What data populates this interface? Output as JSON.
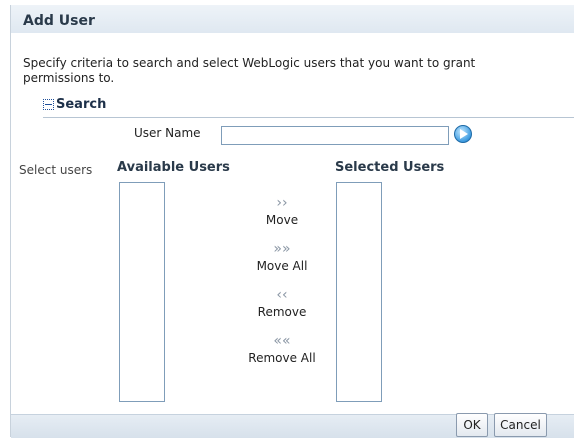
{
  "dialog": {
    "title": "Add User",
    "description": "Specify criteria to search and select WebLogic users that you want to grant permissions to."
  },
  "search": {
    "section_label": "Search",
    "username_label": "User Name",
    "username_value": "",
    "go_icon": "go-arrow-icon"
  },
  "shuttle": {
    "select_label": "Select users",
    "available_header": "Available Users",
    "selected_header": "Selected Users",
    "available_items": [],
    "selected_items": [],
    "move_label": "Move",
    "move_all_label": "Move All",
    "remove_label": "Remove",
    "remove_all_label": "Remove All"
  },
  "footer": {
    "ok_label": "OK",
    "cancel_label": "Cancel"
  }
}
